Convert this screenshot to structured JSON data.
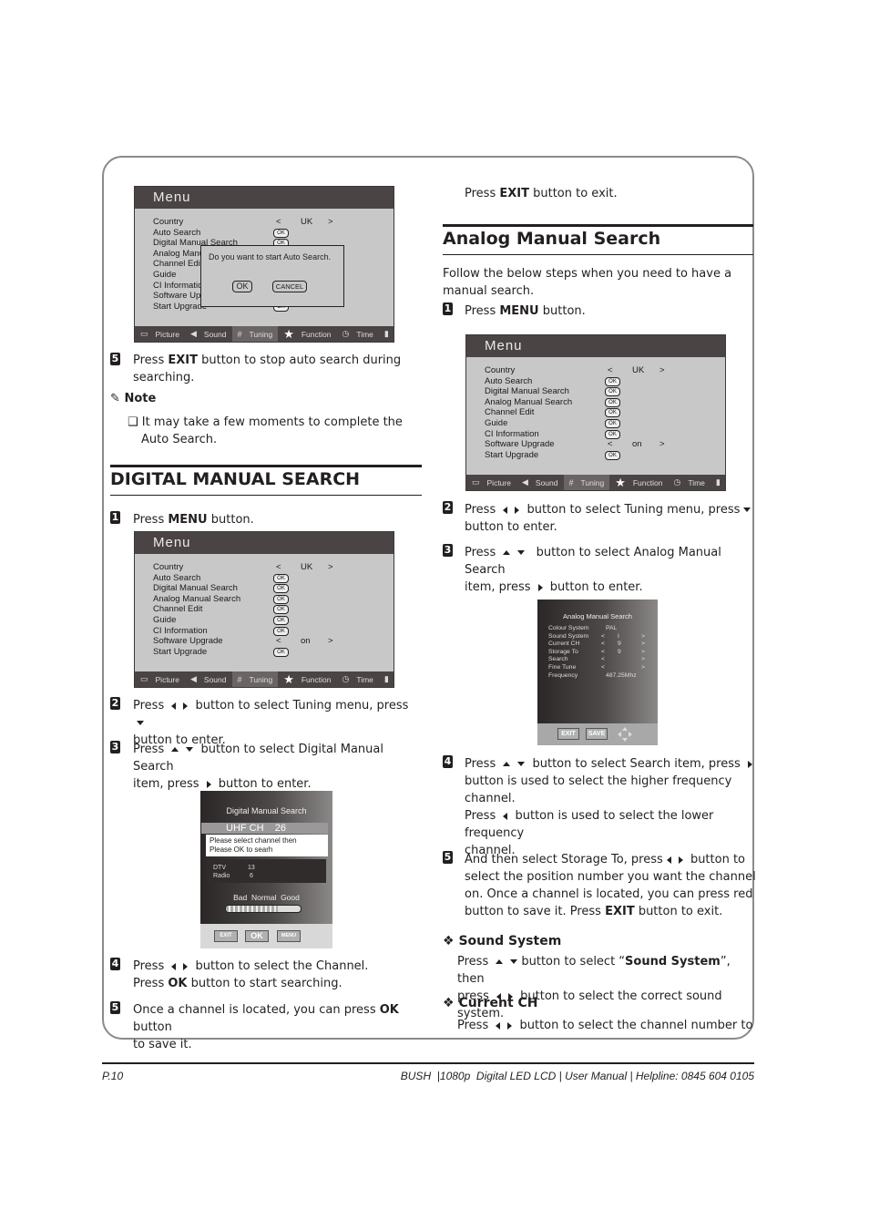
{
  "menu_screen": {
    "title": "Menu",
    "items": [
      {
        "label": "Country",
        "control": "select",
        "value": "UK"
      },
      {
        "label": "Auto Search",
        "control": "ok"
      },
      {
        "label": "Digital Manual Search",
        "control": "ok"
      },
      {
        "label": "Analog Manual Search",
        "control": "ok"
      },
      {
        "label": "Channel Edit",
        "control": "ok"
      },
      {
        "label": "Guide",
        "control": "ok"
      },
      {
        "label": "CI Information",
        "control": "ok"
      },
      {
        "label": "Software Upgrade",
        "control": "select",
        "value": "on"
      },
      {
        "label": "Start Upgrade",
        "control": "ok"
      }
    ],
    "ok_label": "OK",
    "left_arrow": "<",
    "right_arrow": ">",
    "tabs": [
      {
        "label": "Picture",
        "icon": "picture-icon"
      },
      {
        "label": "Sound",
        "icon": "speaker-icon"
      },
      {
        "label": "Tuning",
        "icon": "grid-icon",
        "active": true
      },
      {
        "label": "Function",
        "icon": "star-icon"
      },
      {
        "label": "Time",
        "icon": "clock-icon"
      },
      {
        "label": "Lock",
        "icon": "lock-icon"
      }
    ],
    "dialog": {
      "question": "Do you want to start Auto Search.",
      "ok": "OK",
      "cancel": "CANCEL"
    }
  },
  "left_column": {
    "step5_autosearch": {
      "num": "5",
      "pre": "Press ",
      "bold": "EXIT",
      "post": " button to stop auto search during searching."
    },
    "note_title": "Note",
    "note_text": "It may take a few moments to complete the Auto Search.",
    "digital_heading": "DIGITAL MANUAL SEARCH",
    "step1": {
      "num": "1",
      "pre": "Press ",
      "bold": "MENU",
      "post": " button."
    },
    "step2": {
      "num": "2",
      "a": "Press",
      "b": "button to select Tuning menu, press",
      "c": "button to enter."
    },
    "step3": {
      "num": "3",
      "a": "Press",
      "b": "button to select Digital Manual Search",
      "c": "item, press",
      "d": "button to enter."
    },
    "step4": {
      "num": "4",
      "a": "Press",
      "b": "button to select the Channel.",
      "c_pre": "Press ",
      "c_bold": "OK",
      "c_post": " button to start searching."
    },
    "step5": {
      "num": "5",
      "pre": "Once a channel is located, you can press ",
      "bold": "OK",
      "post": " button",
      "line2": "to save it."
    }
  },
  "dms_screen": {
    "title": "Digital Manual Search",
    "band": "UHF CH",
    "channel": "26",
    "message_line1": "Please select channel then",
    "message_line2": "Please OK to searh",
    "dtv_label": "DTV",
    "dtv_count": "13",
    "radio_label": "Radio",
    "radio_count": "6",
    "quality_labels": "Bad  Normal  Good",
    "signal_fraction": 0.7,
    "buttons": [
      "EXIT",
      "OK",
      "MENU"
    ]
  },
  "right_column": {
    "exit_line": {
      "pre": "Press ",
      "bold": "EXIT",
      "post": " button to exit."
    },
    "analog_heading": "Analog Manual Search",
    "intro": "Follow the below steps when you need to have a manual search.",
    "step1": {
      "num": "1",
      "pre": "Press ",
      "bold": "MENU",
      "post": " button."
    },
    "step2": {
      "num": "2",
      "a": "Press",
      "b": "button to select Tuning menu, press",
      "c": "button to enter."
    },
    "step3": {
      "num": "3",
      "a": "Press",
      "b": "button to select Analog Manual Search",
      "c": "item, press",
      "d": "button to enter."
    },
    "step4": {
      "num": "4",
      "a": "Press",
      "b": "button to select Search item, press",
      "c": "button is used to select the higher frequency",
      "d": "channel.",
      "e": "Press",
      "f": "button is used to select the lower frequency",
      "g": "channel."
    },
    "step5": {
      "num": "5",
      "a": "And then select Storage To, press",
      "b": "button to",
      "c": "select the position number you want the channel",
      "d": "on. Once a channel is located, you can press red",
      "e_pre": "button to save it. Press ",
      "e_bold": "EXIT",
      "e_post": " button to exit."
    },
    "sound_system": {
      "title": "Sound System",
      "a": "Press",
      "b_pre": "button to select “",
      "b_bold": "Sound System",
      "b_post": "”, then",
      "c": "press",
      "d": "button to select the correct sound system."
    },
    "current_ch": {
      "title": "Current CH",
      "a": "Press",
      "b": "button to select the channel number to"
    }
  },
  "ams_screen": {
    "title": "Analog Manual Search",
    "rows": [
      {
        "label": "Colour System",
        "value": "PAL",
        "arrows": false
      },
      {
        "label": "Sound System",
        "value": "I",
        "arrows": true
      },
      {
        "label": "Current CH",
        "value": "9",
        "arrows": true
      },
      {
        "label": "Storage To",
        "value": "9",
        "arrows": true
      },
      {
        "label": "Search",
        "value": "",
        "arrows": true
      },
      {
        "label": "Fine Tune",
        "value": "",
        "arrows": true
      },
      {
        "label": "Frequency",
        "value": "487.25Mhz",
        "arrows": false
      }
    ],
    "buttons": [
      "EXIT",
      "SAVE"
    ]
  },
  "footer": {
    "page": "P.10",
    "info": "BUSH  |1080p  Digital LED LCD | User Manual | Helpline: 0845 604 0105"
  }
}
